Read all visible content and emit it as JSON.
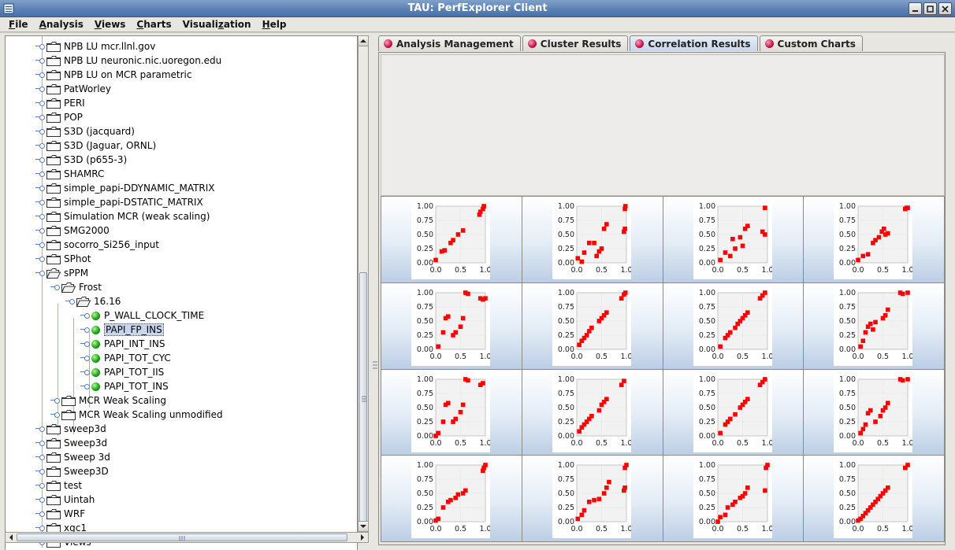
{
  "window": {
    "title": "TAU: PerfExplorer Client"
  },
  "menu": [
    {
      "pre": "",
      "u": "F",
      "post": "ile"
    },
    {
      "pre": "",
      "u": "A",
      "post": "nalysis"
    },
    {
      "pre": "",
      "u": "V",
      "post": "iews"
    },
    {
      "pre": "",
      "u": "C",
      "post": "harts"
    },
    {
      "pre": "Visuali",
      "u": "z",
      "post": "ation"
    },
    {
      "pre": "",
      "u": "H",
      "post": "elp"
    }
  ],
  "tree": [
    {
      "label": "NPB LU mcr.llnl.gov",
      "depth": 0,
      "icon": "folder"
    },
    {
      "label": "NPB LU neuronic.nic.uoregon.edu",
      "depth": 0,
      "icon": "folder"
    },
    {
      "label": "NPB LU on MCR parametric",
      "depth": 0,
      "icon": "folder"
    },
    {
      "label": "PatWorley",
      "depth": 0,
      "icon": "folder"
    },
    {
      "label": "PERI",
      "depth": 0,
      "icon": "folder"
    },
    {
      "label": "POP",
      "depth": 0,
      "icon": "folder"
    },
    {
      "label": "S3D (jacquard)",
      "depth": 0,
      "icon": "folder"
    },
    {
      "label": "S3D (Jaguar, ORNL)",
      "depth": 0,
      "icon": "folder"
    },
    {
      "label": "S3D (p655-3)",
      "depth": 0,
      "icon": "folder"
    },
    {
      "label": "SHAMRC",
      "depth": 0,
      "icon": "folder"
    },
    {
      "label": "simple_papi-DDYNAMIC_MATRIX",
      "depth": 0,
      "icon": "folder"
    },
    {
      "label": "simple_papi-DSTATIC_MATRIX",
      "depth": 0,
      "icon": "folder"
    },
    {
      "label": "Simulation MCR (weak scaling)",
      "depth": 0,
      "icon": "folder"
    },
    {
      "label": "SMG2000",
      "depth": 0,
      "icon": "folder"
    },
    {
      "label": "socorro_Si256_input",
      "depth": 0,
      "icon": "folder"
    },
    {
      "label": "SPhot",
      "depth": 0,
      "icon": "folder"
    },
    {
      "label": "sPPM",
      "depth": 0,
      "icon": "folder",
      "open": true
    },
    {
      "label": "Frost",
      "depth": 1,
      "icon": "folder",
      "open": true
    },
    {
      "label": "16.16",
      "depth": 2,
      "icon": "folder",
      "open": true
    },
    {
      "label": "P_WALL_CLOCK_TIME",
      "depth": 3,
      "icon": "ball"
    },
    {
      "label": "PAPI_FP_INS",
      "depth": 3,
      "icon": "ball",
      "selected": true
    },
    {
      "label": "PAPI_INT_INS",
      "depth": 3,
      "icon": "ball"
    },
    {
      "label": "PAPI_TOT_CYC",
      "depth": 3,
      "icon": "ball"
    },
    {
      "label": "PAPI_TOT_IIS",
      "depth": 3,
      "icon": "ball"
    },
    {
      "label": "PAPI_TOT_INS",
      "depth": 3,
      "icon": "ball"
    },
    {
      "label": "MCR Weak Scaling",
      "depth": 1,
      "icon": "folder"
    },
    {
      "label": "MCR Weak Scaling unmodified",
      "depth": 1,
      "icon": "folder"
    },
    {
      "label": "sweep3d",
      "depth": 0,
      "icon": "folder"
    },
    {
      "label": "Sweep3d",
      "depth": 0,
      "icon": "folder"
    },
    {
      "label": "Sweep 3d",
      "depth": 0,
      "icon": "folder"
    },
    {
      "label": "Sweep3D",
      "depth": 0,
      "icon": "folder"
    },
    {
      "label": "test",
      "depth": 0,
      "icon": "folder"
    },
    {
      "label": "Uintah",
      "depth": 0,
      "icon": "folder"
    },
    {
      "label": "WRF",
      "depth": 0,
      "icon": "folder"
    },
    {
      "label": "xgc1",
      "depth": 0,
      "icon": "folder"
    },
    {
      "label": "Views",
      "depth": 0,
      "icon": "folder"
    }
  ],
  "tabs": [
    {
      "label": "Analysis Management",
      "active": false
    },
    {
      "label": "Cluster Results",
      "active": false
    },
    {
      "label": "Correlation Results",
      "active": true
    },
    {
      "label": "Custom Charts",
      "active": false
    }
  ],
  "chart_data": {
    "type": "scatter",
    "xticks": [
      "0.0",
      "0.5",
      "1.0"
    ],
    "yticks": [
      "0.00",
      "0.25",
      "0.50",
      "0.75",
      "1.00"
    ],
    "xlim": [
      0,
      1
    ],
    "ylim": [
      0,
      1
    ],
    "point_color": "#ff0000",
    "plots": [
      [
        [
          0.0,
          0.05
        ],
        [
          0.12,
          0.2
        ],
        [
          0.18,
          0.22
        ],
        [
          0.3,
          0.35
        ],
        [
          0.35,
          0.4
        ],
        [
          0.45,
          0.5
        ],
        [
          0.55,
          0.57
        ],
        [
          0.88,
          0.85
        ],
        [
          0.9,
          0.9
        ],
        [
          0.95,
          0.95
        ],
        [
          0.97,
          1.0
        ]
      ],
      [
        [
          0.02,
          0.08
        ],
        [
          0.1,
          0.02
        ],
        [
          0.15,
          0.18
        ],
        [
          0.25,
          0.35
        ],
        [
          0.35,
          0.35
        ],
        [
          0.4,
          0.12
        ],
        [
          0.45,
          0.2
        ],
        [
          0.5,
          0.25
        ],
        [
          0.55,
          0.6
        ],
        [
          0.6,
          0.68
        ],
        [
          0.95,
          0.55
        ],
        [
          0.97,
          0.6
        ],
        [
          0.97,
          0.95
        ],
        [
          0.98,
          1.0
        ]
      ],
      [
        [
          0.05,
          0.05
        ],
        [
          0.15,
          0.18
        ],
        [
          0.25,
          0.12
        ],
        [
          0.3,
          0.42
        ],
        [
          0.35,
          0.25
        ],
        [
          0.45,
          0.45
        ],
        [
          0.5,
          0.3
        ],
        [
          0.55,
          0.6
        ],
        [
          0.6,
          0.65
        ],
        [
          0.9,
          0.55
        ],
        [
          0.95,
          0.5
        ],
        [
          0.95,
          0.97
        ]
      ],
      [
        [
          0.0,
          0.05
        ],
        [
          0.1,
          0.12
        ],
        [
          0.2,
          0.15
        ],
        [
          0.3,
          0.35
        ],
        [
          0.35,
          0.4
        ],
        [
          0.42,
          0.45
        ],
        [
          0.48,
          0.55
        ],
        [
          0.52,
          0.6
        ],
        [
          0.55,
          0.5
        ],
        [
          0.6,
          0.52
        ],
        [
          0.95,
          0.95
        ],
        [
          0.98,
          0.97
        ],
        [
          1.0,
          0.97
        ]
      ],
      [
        [
          0.05,
          0.05
        ],
        [
          0.15,
          0.3
        ],
        [
          0.2,
          0.55
        ],
        [
          0.25,
          0.58
        ],
        [
          0.35,
          0.25
        ],
        [
          0.4,
          0.3
        ],
        [
          0.5,
          0.4
        ],
        [
          0.55,
          0.55
        ],
        [
          0.6,
          1.0
        ],
        [
          0.65,
          0.98
        ],
        [
          0.9,
          0.9
        ],
        [
          0.95,
          0.88
        ],
        [
          1.0,
          0.9
        ]
      ],
      [
        [
          0.05,
          0.08
        ],
        [
          0.1,
          0.15
        ],
        [
          0.15,
          0.2
        ],
        [
          0.2,
          0.25
        ],
        [
          0.25,
          0.32
        ],
        [
          0.3,
          0.38
        ],
        [
          0.45,
          0.5
        ],
        [
          0.5,
          0.55
        ],
        [
          0.55,
          0.6
        ],
        [
          0.6,
          0.65
        ],
        [
          0.9,
          0.9
        ],
        [
          0.95,
          0.97
        ],
        [
          0.98,
          1.0
        ]
      ],
      [
        [
          0.05,
          0.05
        ],
        [
          0.15,
          0.2
        ],
        [
          0.2,
          0.25
        ],
        [
          0.25,
          0.3
        ],
        [
          0.35,
          0.38
        ],
        [
          0.4,
          0.45
        ],
        [
          0.45,
          0.5
        ],
        [
          0.5,
          0.55
        ],
        [
          0.55,
          0.6
        ],
        [
          0.6,
          0.65
        ],
        [
          0.85,
          0.9
        ],
        [
          0.9,
          0.95
        ],
        [
          0.95,
          1.0
        ]
      ],
      [
        [
          0.05,
          0.05
        ],
        [
          0.1,
          0.15
        ],
        [
          0.15,
          0.3
        ],
        [
          0.2,
          0.4
        ],
        [
          0.25,
          0.45
        ],
        [
          0.3,
          0.35
        ],
        [
          0.35,
          0.48
        ],
        [
          0.5,
          0.55
        ],
        [
          0.55,
          0.6
        ],
        [
          0.6,
          0.7
        ],
        [
          0.85,
          1.0
        ],
        [
          0.9,
          0.98
        ],
        [
          1.0,
          1.0
        ]
      ],
      [
        [
          0.0,
          0.0
        ],
        [
          0.05,
          0.05
        ],
        [
          0.15,
          0.25
        ],
        [
          0.2,
          0.55
        ],
        [
          0.25,
          0.58
        ],
        [
          0.35,
          0.25
        ],
        [
          0.4,
          0.3
        ],
        [
          0.5,
          0.42
        ],
        [
          0.55,
          0.55
        ],
        [
          0.6,
          1.0
        ],
        [
          0.65,
          0.98
        ],
        [
          0.9,
          0.9
        ],
        [
          0.95,
          0.93
        ]
      ],
      [
        [
          0.05,
          0.08
        ],
        [
          0.1,
          0.15
        ],
        [
          0.15,
          0.2
        ],
        [
          0.2,
          0.25
        ],
        [
          0.25,
          0.3
        ],
        [
          0.3,
          0.35
        ],
        [
          0.45,
          0.45
        ],
        [
          0.5,
          0.55
        ],
        [
          0.55,
          0.6
        ],
        [
          0.6,
          0.65
        ],
        [
          0.9,
          0.9
        ],
        [
          0.95,
          0.97
        ]
      ],
      [
        [
          0.05,
          0.05
        ],
        [
          0.15,
          0.2
        ],
        [
          0.2,
          0.25
        ],
        [
          0.25,
          0.3
        ],
        [
          0.35,
          0.38
        ],
        [
          0.45,
          0.5
        ],
        [
          0.5,
          0.55
        ],
        [
          0.55,
          0.6
        ],
        [
          0.6,
          0.65
        ],
        [
          0.85,
          0.9
        ],
        [
          0.9,
          0.95
        ],
        [
          0.95,
          1.0
        ]
      ],
      [
        [
          0.05,
          0.05
        ],
        [
          0.1,
          0.12
        ],
        [
          0.15,
          0.2
        ],
        [
          0.2,
          0.4
        ],
        [
          0.25,
          0.45
        ],
        [
          0.35,
          0.25
        ],
        [
          0.45,
          0.35
        ],
        [
          0.5,
          0.45
        ],
        [
          0.55,
          0.5
        ],
        [
          0.6,
          0.58
        ],
        [
          0.85,
          1.0
        ],
        [
          0.9,
          0.98
        ],
        [
          1.0,
          1.0
        ]
      ],
      [
        [
          0.0,
          0.02
        ],
        [
          0.05,
          0.05
        ],
        [
          0.15,
          0.25
        ],
        [
          0.25,
          0.35
        ],
        [
          0.3,
          0.38
        ],
        [
          0.4,
          0.42
        ],
        [
          0.45,
          0.48
        ],
        [
          0.55,
          0.5
        ],
        [
          0.6,
          0.55
        ],
        [
          0.95,
          0.9
        ],
        [
          0.97,
          0.95
        ],
        [
          1.0,
          1.0
        ]
      ],
      [
        [
          0.02,
          0.05
        ],
        [
          0.1,
          0.12
        ],
        [
          0.15,
          0.2
        ],
        [
          0.25,
          0.35
        ],
        [
          0.35,
          0.38
        ],
        [
          0.45,
          0.4
        ],
        [
          0.55,
          0.5
        ],
        [
          0.6,
          0.6
        ],
        [
          0.65,
          0.7
        ],
        [
          0.95,
          0.55
        ],
        [
          0.97,
          0.6
        ],
        [
          0.97,
          0.95
        ],
        [
          1.0,
          1.0
        ]
      ],
      [
        [
          0.0,
          0.0
        ],
        [
          0.05,
          0.08
        ],
        [
          0.15,
          0.12
        ],
        [
          0.2,
          0.25
        ],
        [
          0.3,
          0.3
        ],
        [
          0.35,
          0.35
        ],
        [
          0.45,
          0.42
        ],
        [
          0.5,
          0.45
        ],
        [
          0.55,
          0.5
        ],
        [
          0.6,
          0.6
        ],
        [
          0.95,
          0.55
        ],
        [
          0.97,
          0.95
        ],
        [
          1.0,
          1.0
        ]
      ],
      [
        [
          0.0,
          0.02
        ],
        [
          0.05,
          0.05
        ],
        [
          0.1,
          0.1
        ],
        [
          0.15,
          0.15
        ],
        [
          0.2,
          0.2
        ],
        [
          0.25,
          0.25
        ],
        [
          0.3,
          0.3
        ],
        [
          0.35,
          0.35
        ],
        [
          0.4,
          0.4
        ],
        [
          0.45,
          0.45
        ],
        [
          0.5,
          0.5
        ],
        [
          0.55,
          0.55
        ],
        [
          0.6,
          0.6
        ],
        [
          0.95,
          0.95
        ],
        [
          1.0,
          1.0
        ]
      ]
    ]
  }
}
